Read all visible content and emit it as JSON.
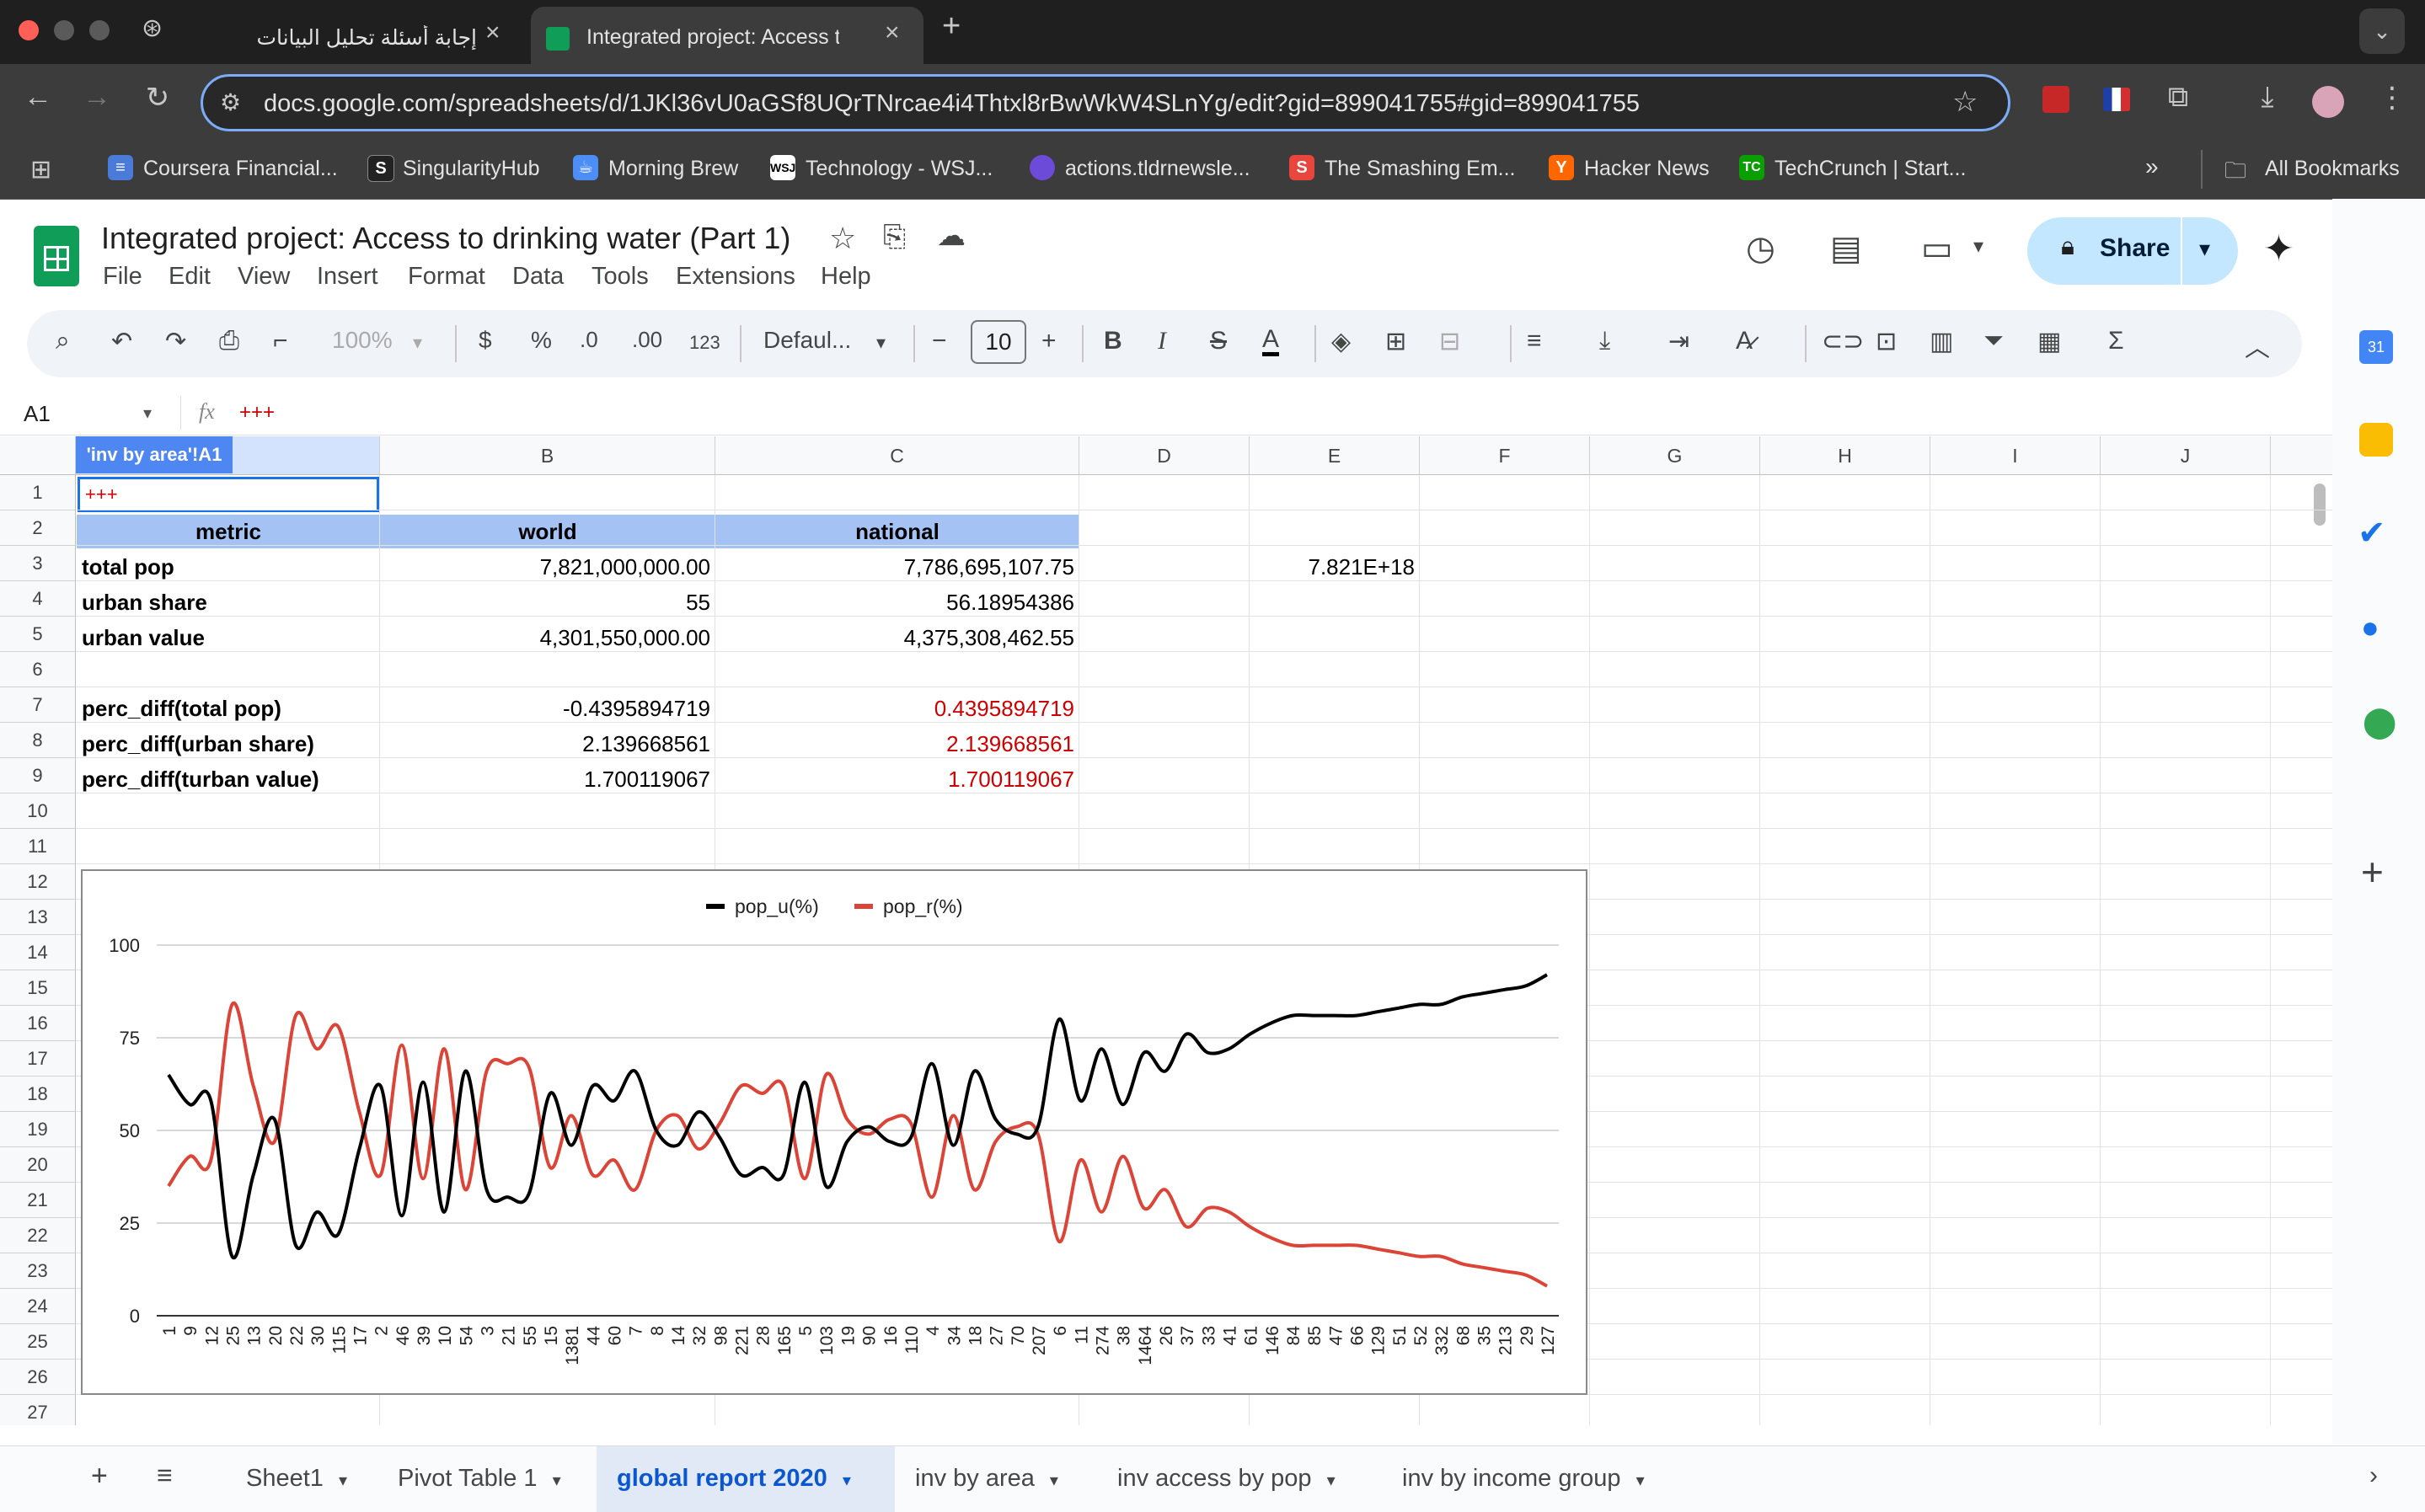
{
  "browser": {
    "tabs": [
      {
        "title": "إجابة أسئلة تحليل البيانات",
        "active": false
      },
      {
        "title": "Integrated project: Access to",
        "active": true
      }
    ],
    "url": "docs.google.com/spreadsheets/d/1JKl36vU0aGSf8UQrTNrcae4i4Thtxl8rBwWkW4SLnYg/edit?gid=899041755#gid=899041755",
    "bookmarks": [
      "Coursera Financial...",
      "SingularityHub",
      "Morning Brew",
      "Technology - WSJ...",
      "actions.tldrnewsle...",
      "The Smashing Em...",
      "Hacker News",
      "TechCrunch | Start..."
    ],
    "all_bookmarks": "All Bookmarks"
  },
  "doc": {
    "title": "Integrated project: Access to drinking water (Part 1)",
    "menus": [
      "File",
      "Edit",
      "View",
      "Insert",
      "Format",
      "Data",
      "Tools",
      "Extensions",
      "Help"
    ],
    "share_label": "Share"
  },
  "format_toolbar": {
    "zoom": "100%",
    "currency": "$",
    "percent": "%",
    "dec_decrease": ".0",
    "dec_increase": ".00",
    "number_format": "123",
    "font": "Defaul...",
    "font_size": "10",
    "bold": "B",
    "italic": "I",
    "strike": "S",
    "text_color": "A"
  },
  "formula_bar": {
    "cell_ref": "A1",
    "fx": "fx",
    "content": "+++"
  },
  "grid": {
    "columns": [
      "A",
      "B",
      "C",
      "D",
      "E",
      "F",
      "G",
      "H",
      "I",
      "J"
    ],
    "col_a_header": "'inv by area'!A1",
    "rows": [
      "1",
      "2",
      "3",
      "4",
      "5",
      "6",
      "7",
      "8",
      "9",
      "10",
      "11",
      "12",
      "13",
      "14",
      "15",
      "16",
      "17",
      "18",
      "19",
      "20",
      "21",
      "22",
      "23",
      "24",
      "25",
      "26",
      "27"
    ],
    "a1": "+++",
    "header": {
      "metric": "metric",
      "world": "world",
      "national": "national"
    },
    "data": [
      {
        "label": "total pop",
        "world": "7,821,000,000.00",
        "national": "7,786,695,107.75",
        "e": "7.821E+18"
      },
      {
        "label": "urban share",
        "world": "55",
        "national": "56.18954386",
        "e": ""
      },
      {
        "label": "urban value",
        "world": "4,301,550,000.00",
        "national": "4,375,308,462.55",
        "e": ""
      }
    ],
    "diffs": [
      {
        "label": "perc_diff(total pop)",
        "world": "-0.4395894719",
        "national": "0.4395894719"
      },
      {
        "label": "perc_diff(urban share)",
        "world": "2.139668561",
        "national": "2.139668561"
      },
      {
        "label": "perc_diff(turban value)",
        "world": "1.700119067",
        "national": "1.700119067"
      }
    ]
  },
  "sheet_tabs": [
    "Sheet1",
    "Pivot Table 1",
    "global report 2020",
    "inv by area",
    "inv access by pop",
    "inv by income group"
  ],
  "active_sheet": "global report 2020",
  "colors": {
    "accent": "#0b57d0",
    "header_fill": "#a4c2f4",
    "urban": "#000000",
    "rural": "#db4437",
    "negative": "#cc0000"
  },
  "chart_data": {
    "type": "line",
    "title": "",
    "legend_position": "top",
    "ylim": [
      0,
      100
    ],
    "yticks": [
      0,
      25,
      50,
      75,
      100
    ],
    "grid": true,
    "categories": [
      "1",
      "9",
      "12",
      "25",
      "13",
      "20",
      "22",
      "30",
      "115",
      "17",
      "2",
      "46",
      "39",
      "10",
      "54",
      "3",
      "21",
      "55",
      "15",
      "1381",
      "44",
      "60",
      "7",
      "8",
      "14",
      "32",
      "98",
      "221",
      "28",
      "165",
      "5",
      "103",
      "19",
      "90",
      "16",
      "110",
      "4",
      "34",
      "18",
      "27",
      "70",
      "207",
      "6",
      "11",
      "274",
      "38",
      "1464",
      "26",
      "37",
      "33",
      "41",
      "61",
      "146",
      "84",
      "85",
      "47",
      "66",
      "129",
      "51",
      "52",
      "332",
      "68",
      "35",
      "213",
      "29",
      "127"
    ],
    "series": [
      {
        "name": "pop_u(%)",
        "color": "#000000",
        "values": [
          65,
          57,
          58,
          16,
          38,
          53,
          19,
          28,
          22,
          45,
          62,
          27,
          63,
          28,
          66,
          34,
          32,
          33,
          60,
          46,
          62,
          58,
          66,
          50,
          46,
          55,
          48,
          38,
          40,
          38,
          63,
          35,
          47,
          51,
          47,
          48,
          68,
          46,
          66,
          53,
          49,
          51,
          80,
          58,
          72,
          57,
          71,
          66,
          76,
          71,
          72,
          76,
          79,
          81,
          81,
          81,
          81,
          82,
          83,
          84,
          84,
          86,
          87,
          88,
          89,
          92
        ]
      },
      {
        "name": "pop_r(%)",
        "color": "#db4437",
        "values": [
          35,
          43,
          42,
          84,
          62,
          47,
          81,
          72,
          78,
          55,
          38,
          73,
          37,
          72,
          34,
          66,
          68,
          67,
          40,
          54,
          38,
          42,
          34,
          50,
          54,
          45,
          52,
          62,
          60,
          62,
          37,
          65,
          53,
          49,
          53,
          52,
          32,
          54,
          34,
          47,
          51,
          49,
          20,
          42,
          28,
          43,
          29,
          34,
          24,
          29,
          28,
          24,
          21,
          19,
          19,
          19,
          19,
          18,
          17,
          16,
          16,
          14,
          13,
          12,
          11,
          8
        ]
      }
    ]
  }
}
